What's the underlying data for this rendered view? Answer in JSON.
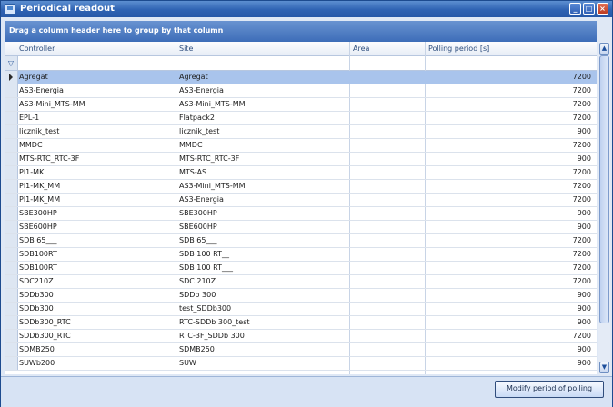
{
  "window": {
    "title": "Periodical readout"
  },
  "group_panel": {
    "text": "Drag a column header here to group by that column"
  },
  "columns": [
    "Controller",
    "Site",
    "Area",
    "Polling period [s]"
  ],
  "rows": [
    {
      "controller": "Agregat",
      "site": "Agregat",
      "area": "",
      "period": "7200"
    },
    {
      "controller": "AS3-Energia",
      "site": "AS3-Energia",
      "area": "",
      "period": "7200"
    },
    {
      "controller": "AS3-Mini_MTS-MM",
      "site": "AS3-Mini_MTS-MM",
      "area": "",
      "period": "7200"
    },
    {
      "controller": "EPL-1",
      "site": "Flatpack2",
      "area": "",
      "period": "7200"
    },
    {
      "controller": "licznik_test",
      "site": "licznik_test",
      "area": "",
      "period": "900"
    },
    {
      "controller": "MMDC",
      "site": "MMDC",
      "area": "",
      "period": "7200"
    },
    {
      "controller": "MTS-RTC_RTC-3F",
      "site": "MTS-RTC_RTC-3F",
      "area": "",
      "period": "900"
    },
    {
      "controller": "PI1-MK",
      "site": "MTS-AS",
      "area": "",
      "period": "7200"
    },
    {
      "controller": "PI1-MK_MM",
      "site": "AS3-Mini_MTS-MM",
      "area": "",
      "period": "7200"
    },
    {
      "controller": "PI1-MK_MM",
      "site": "AS3-Energia",
      "area": "",
      "period": "7200"
    },
    {
      "controller": "SBE300HP",
      "site": "SBE300HP",
      "area": "",
      "period": "900"
    },
    {
      "controller": "SBE600HP",
      "site": "SBE600HP",
      "area": "",
      "period": "900"
    },
    {
      "controller": "SDB 65___",
      "site": "SDB 65___",
      "area": "",
      "period": "7200"
    },
    {
      "controller": "SDB100RT",
      "site": "SDB 100 RT__",
      "area": "",
      "period": "7200"
    },
    {
      "controller": "SDB100RT",
      "site": "SDB 100 RT___",
      "area": "",
      "period": "7200"
    },
    {
      "controller": "SDC210Z",
      "site": "SDC 210Z",
      "area": "",
      "period": "7200"
    },
    {
      "controller": "SDDb300",
      "site": "SDDb 300",
      "area": "",
      "period": "900"
    },
    {
      "controller": "SDDb300",
      "site": "test_SDDb300",
      "area": "",
      "period": "900"
    },
    {
      "controller": "SDDb300_RTC",
      "site": "RTC-SDDb 300_test",
      "area": "",
      "period": "900"
    },
    {
      "controller": "SDDb300_RTC",
      "site": "RTC-3F_SDDb 300",
      "area": "",
      "period": "7200"
    },
    {
      "controller": "SDMB250",
      "site": "SDMB250",
      "area": "",
      "period": "900"
    },
    {
      "controller": "SUWb200",
      "site": "SUW",
      "area": "",
      "period": "900"
    }
  ],
  "footer": {
    "modify_button": "Modify period of polling"
  },
  "icons": {
    "filter": "filter-icon",
    "row_indicator": "current-row-arrow-icon"
  }
}
